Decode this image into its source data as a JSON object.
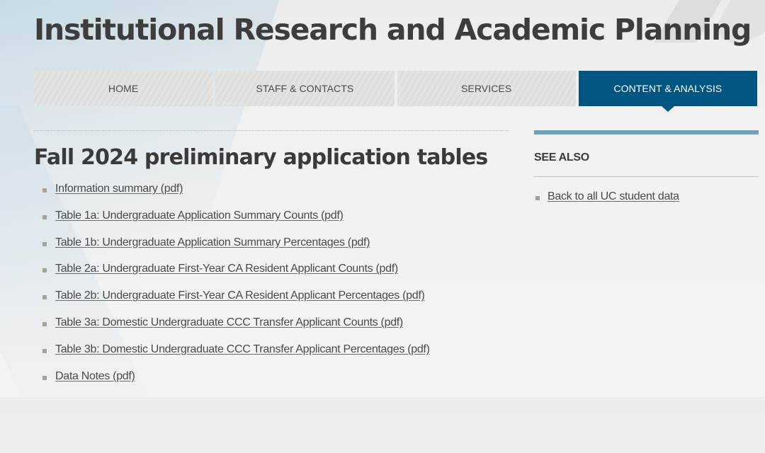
{
  "site": {
    "title": "Institutional Research and Academic Planning"
  },
  "nav": {
    "items": [
      {
        "label": "HOME",
        "active": false
      },
      {
        "label": "STAFF & CONTACTS",
        "active": false
      },
      {
        "label": "SERVICES",
        "active": false
      },
      {
        "label": "CONTENT & ANALYSIS",
        "active": true
      }
    ],
    "active_color": "#005581"
  },
  "main": {
    "heading": "Fall 2024 preliminary application tables",
    "links": [
      {
        "label": "Information summary (pdf)"
      },
      {
        "label": "Table 1a: Undergraduate Application Summary Counts (pdf)"
      },
      {
        "label": "Table 1b: Undergraduate Application Summary Percentages (pdf)"
      },
      {
        "label": "Table 2a: Undergraduate First-Year CA Resident Applicant Counts (pdf)"
      },
      {
        "label": "Table 2b: Undergraduate First-Year CA Resident Applicant Percentages (pdf)"
      },
      {
        "label": "Table 3a: Domestic Undergraduate CCC Transfer Applicant Counts (pdf)"
      },
      {
        "label": "Table 3b: Domestic Undergraduate CCC Transfer Applicant Percentages (pdf)"
      },
      {
        "label": "Data Notes (pdf)"
      }
    ]
  },
  "sidebar": {
    "title": "SEE ALSO",
    "accent_color": "#6aa3ba",
    "links": [
      {
        "label": "Back to all UC student data"
      }
    ]
  }
}
